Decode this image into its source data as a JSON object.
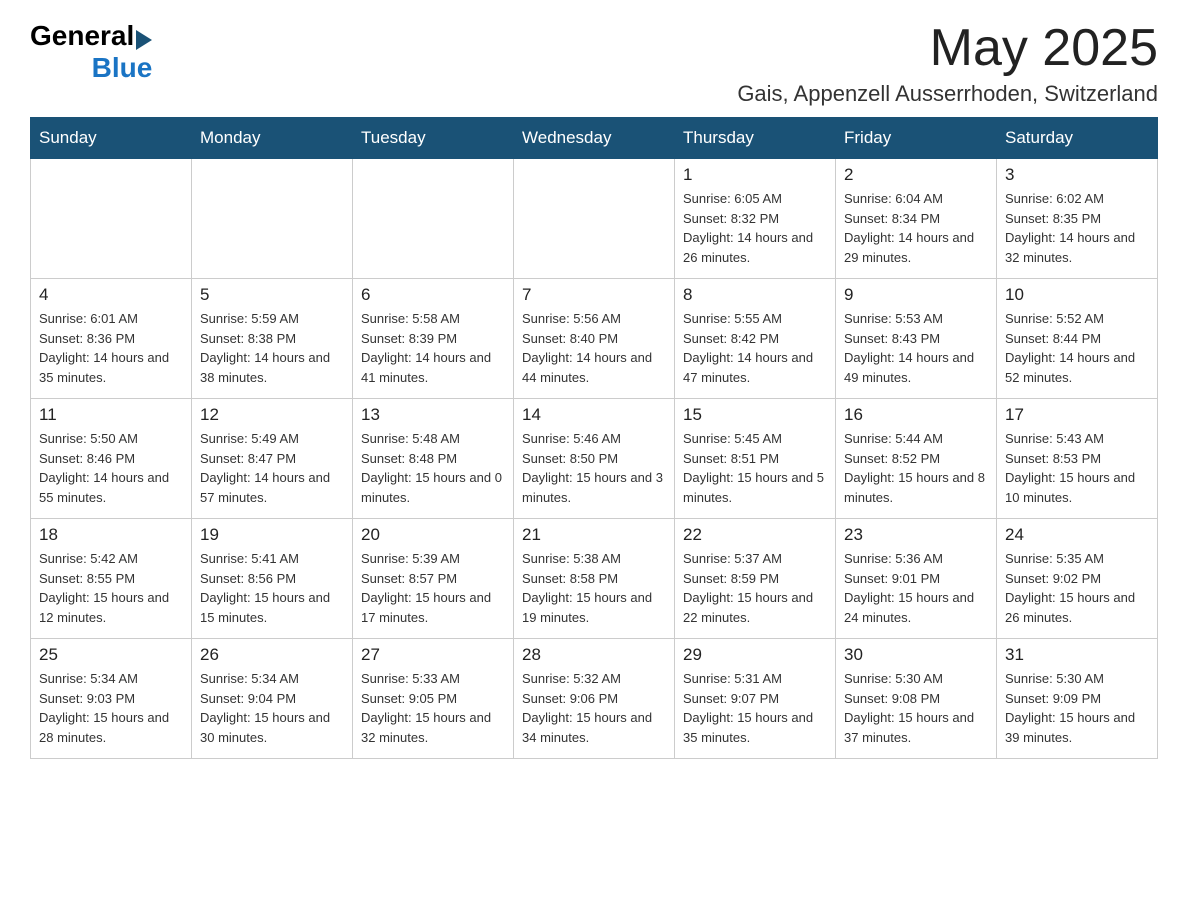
{
  "header": {
    "logo_general": "General",
    "logo_blue": "Blue",
    "month_title": "May 2025",
    "location": "Gais, Appenzell Ausserrhoden, Switzerland"
  },
  "days_of_week": [
    "Sunday",
    "Monday",
    "Tuesday",
    "Wednesday",
    "Thursday",
    "Friday",
    "Saturday"
  ],
  "weeks": [
    {
      "days": [
        {
          "num": "",
          "info": ""
        },
        {
          "num": "",
          "info": ""
        },
        {
          "num": "",
          "info": ""
        },
        {
          "num": "",
          "info": ""
        },
        {
          "num": "1",
          "info": "Sunrise: 6:05 AM\nSunset: 8:32 PM\nDaylight: 14 hours and 26 minutes."
        },
        {
          "num": "2",
          "info": "Sunrise: 6:04 AM\nSunset: 8:34 PM\nDaylight: 14 hours and 29 minutes."
        },
        {
          "num": "3",
          "info": "Sunrise: 6:02 AM\nSunset: 8:35 PM\nDaylight: 14 hours and 32 minutes."
        }
      ]
    },
    {
      "days": [
        {
          "num": "4",
          "info": "Sunrise: 6:01 AM\nSunset: 8:36 PM\nDaylight: 14 hours and 35 minutes."
        },
        {
          "num": "5",
          "info": "Sunrise: 5:59 AM\nSunset: 8:38 PM\nDaylight: 14 hours and 38 minutes."
        },
        {
          "num": "6",
          "info": "Sunrise: 5:58 AM\nSunset: 8:39 PM\nDaylight: 14 hours and 41 minutes."
        },
        {
          "num": "7",
          "info": "Sunrise: 5:56 AM\nSunset: 8:40 PM\nDaylight: 14 hours and 44 minutes."
        },
        {
          "num": "8",
          "info": "Sunrise: 5:55 AM\nSunset: 8:42 PM\nDaylight: 14 hours and 47 minutes."
        },
        {
          "num": "9",
          "info": "Sunrise: 5:53 AM\nSunset: 8:43 PM\nDaylight: 14 hours and 49 minutes."
        },
        {
          "num": "10",
          "info": "Sunrise: 5:52 AM\nSunset: 8:44 PM\nDaylight: 14 hours and 52 minutes."
        }
      ]
    },
    {
      "days": [
        {
          "num": "11",
          "info": "Sunrise: 5:50 AM\nSunset: 8:46 PM\nDaylight: 14 hours and 55 minutes."
        },
        {
          "num": "12",
          "info": "Sunrise: 5:49 AM\nSunset: 8:47 PM\nDaylight: 14 hours and 57 minutes."
        },
        {
          "num": "13",
          "info": "Sunrise: 5:48 AM\nSunset: 8:48 PM\nDaylight: 15 hours and 0 minutes."
        },
        {
          "num": "14",
          "info": "Sunrise: 5:46 AM\nSunset: 8:50 PM\nDaylight: 15 hours and 3 minutes."
        },
        {
          "num": "15",
          "info": "Sunrise: 5:45 AM\nSunset: 8:51 PM\nDaylight: 15 hours and 5 minutes."
        },
        {
          "num": "16",
          "info": "Sunrise: 5:44 AM\nSunset: 8:52 PM\nDaylight: 15 hours and 8 minutes."
        },
        {
          "num": "17",
          "info": "Sunrise: 5:43 AM\nSunset: 8:53 PM\nDaylight: 15 hours and 10 minutes."
        }
      ]
    },
    {
      "days": [
        {
          "num": "18",
          "info": "Sunrise: 5:42 AM\nSunset: 8:55 PM\nDaylight: 15 hours and 12 minutes."
        },
        {
          "num": "19",
          "info": "Sunrise: 5:41 AM\nSunset: 8:56 PM\nDaylight: 15 hours and 15 minutes."
        },
        {
          "num": "20",
          "info": "Sunrise: 5:39 AM\nSunset: 8:57 PM\nDaylight: 15 hours and 17 minutes."
        },
        {
          "num": "21",
          "info": "Sunrise: 5:38 AM\nSunset: 8:58 PM\nDaylight: 15 hours and 19 minutes."
        },
        {
          "num": "22",
          "info": "Sunrise: 5:37 AM\nSunset: 8:59 PM\nDaylight: 15 hours and 22 minutes."
        },
        {
          "num": "23",
          "info": "Sunrise: 5:36 AM\nSunset: 9:01 PM\nDaylight: 15 hours and 24 minutes."
        },
        {
          "num": "24",
          "info": "Sunrise: 5:35 AM\nSunset: 9:02 PM\nDaylight: 15 hours and 26 minutes."
        }
      ]
    },
    {
      "days": [
        {
          "num": "25",
          "info": "Sunrise: 5:34 AM\nSunset: 9:03 PM\nDaylight: 15 hours and 28 minutes."
        },
        {
          "num": "26",
          "info": "Sunrise: 5:34 AM\nSunset: 9:04 PM\nDaylight: 15 hours and 30 minutes."
        },
        {
          "num": "27",
          "info": "Sunrise: 5:33 AM\nSunset: 9:05 PM\nDaylight: 15 hours and 32 minutes."
        },
        {
          "num": "28",
          "info": "Sunrise: 5:32 AM\nSunset: 9:06 PM\nDaylight: 15 hours and 34 minutes."
        },
        {
          "num": "29",
          "info": "Sunrise: 5:31 AM\nSunset: 9:07 PM\nDaylight: 15 hours and 35 minutes."
        },
        {
          "num": "30",
          "info": "Sunrise: 5:30 AM\nSunset: 9:08 PM\nDaylight: 15 hours and 37 minutes."
        },
        {
          "num": "31",
          "info": "Sunrise: 5:30 AM\nSunset: 9:09 PM\nDaylight: 15 hours and 39 minutes."
        }
      ]
    }
  ]
}
